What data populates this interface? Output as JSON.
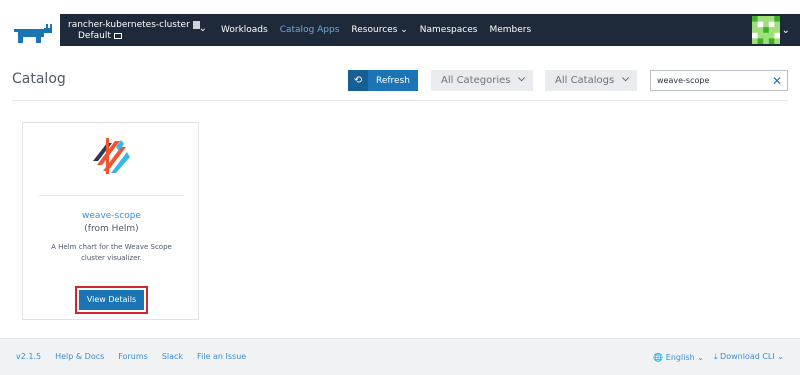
{
  "header": {
    "cluster_name": "rancher-kubernetes-cluster",
    "project_name": "Default",
    "nav": [
      {
        "label": "Workloads"
      },
      {
        "label": "Catalog Apps",
        "active": true
      },
      {
        "label": "Resources ⌄"
      },
      {
        "label": "Namespaces"
      },
      {
        "label": "Members"
      }
    ]
  },
  "page": {
    "title": "Catalog",
    "refresh_label": "Refresh",
    "categories_label": "All Categories",
    "catalogs_label": "All Catalogs",
    "search_value": "weave-scope"
  },
  "card": {
    "title": "weave-scope",
    "source": "(from Helm)",
    "description": "A Helm chart for the Weave Scope cluster visualizer.",
    "button_label": "View Details"
  },
  "footer": {
    "version": "v2.1.5",
    "links": [
      "Help & Docs",
      "Forums",
      "Slack",
      "File an Issue"
    ],
    "language": "English",
    "download": "Download CLI"
  },
  "colors": {
    "navbar": "#1e2a3a",
    "primary": "#1b74b3",
    "link": "#3d8fd1",
    "highlight_outline": "#d0262f"
  }
}
